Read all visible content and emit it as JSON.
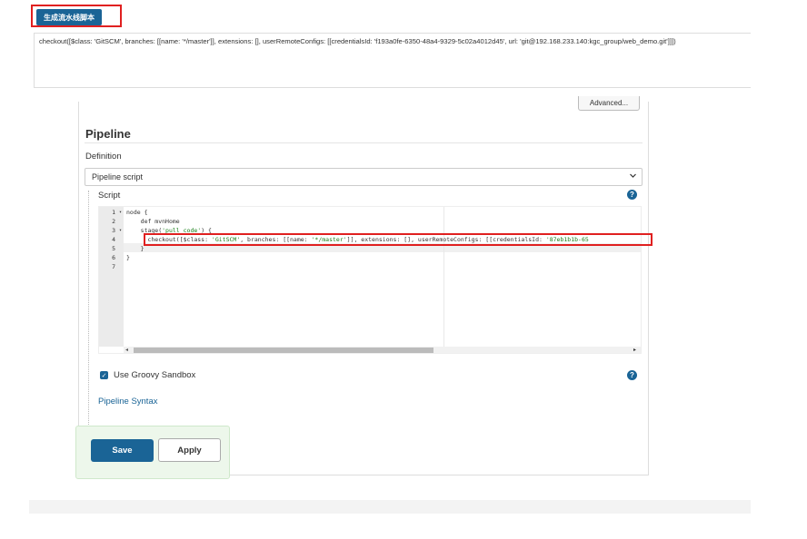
{
  "snippet_generator": {
    "button_label": "生成流水线脚本",
    "output_text": "checkout([$class: 'GitSCM', branches: [[name: '*/master']], extensions: [], userRemoteConfigs: [[credentialsId: 'f193a0fe-6350-48a4-9329-5c02a4012d45', url: 'git@192.168.233.140:kgc_group/web_demo.git']]])"
  },
  "config": {
    "advanced_label": "Advanced...",
    "section_title": "Pipeline",
    "definition_label": "Definition",
    "definition_value": "Pipeline script",
    "script_label": "Script",
    "help_glyph": "?",
    "use_sandbox_label": "Use Groovy Sandbox",
    "use_sandbox_checked": true,
    "pipeline_syntax_link": "Pipeline Syntax"
  },
  "editor": {
    "line_numbers": [
      "1",
      "2",
      "3",
      "4",
      "5",
      "6",
      "7"
    ],
    "fold_markers": [
      "▾",
      "",
      "▾",
      "",
      "",
      "",
      ""
    ],
    "active_line": 5,
    "lines": [
      "node {",
      "    def mvnHome",
      "    stage('pull code') {",
      "      checkout([$class: 'GitSCM', branches: [[name: '*/master']], extensions: [], userRemoteConfigs: [[credentialsId: '87eb1b1b-65",
      "    }",
      "}",
      ""
    ]
  },
  "actions": {
    "save_label": "Save",
    "apply_label": "Apply"
  },
  "colors": {
    "primary": "#1a6496",
    "highlight": "#e02020",
    "string": "#1a7f1a",
    "button_bar_bg": "#edf7eb"
  }
}
